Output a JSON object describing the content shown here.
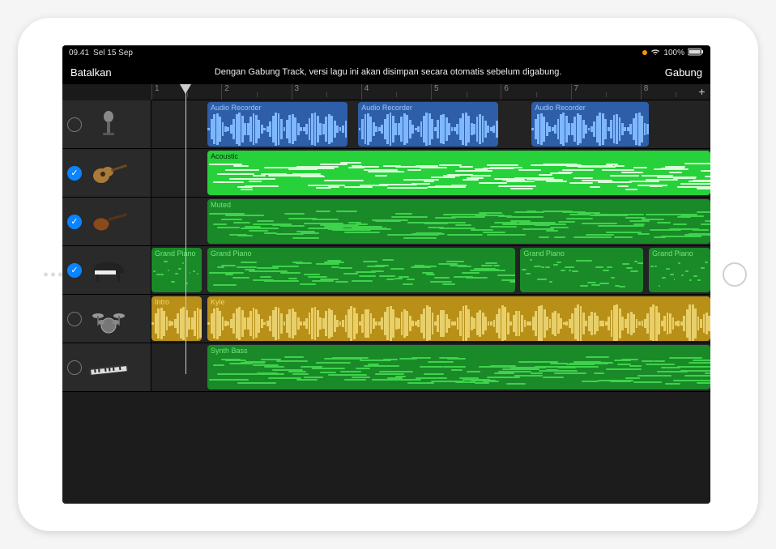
{
  "status": {
    "time": "09.41",
    "date": "Sel 15 Sep",
    "battery": "100%"
  },
  "header": {
    "cancel": "Batalkan",
    "message": "Dengan Gabung Track, versi lagu ini akan disimpan secara otomatis sebelum digabung.",
    "merge": "Gabung"
  },
  "ruler": {
    "marks": [
      "1",
      "2",
      "3",
      "4",
      "5",
      "6",
      "7",
      "8"
    ],
    "add_label": "+"
  },
  "tracks": [
    {
      "id": "mic",
      "instrument": "microphone",
      "checked": false,
      "regions": [
        {
          "label": "Audio Recorder",
          "type": "audio",
          "start": 10,
          "width": 25
        },
        {
          "label": "Audio Recorder",
          "type": "audio",
          "start": 37,
          "width": 25
        },
        {
          "label": "Audio Recorder",
          "type": "audio",
          "start": 68,
          "width": 21
        }
      ]
    },
    {
      "id": "acoustic-guitar",
      "instrument": "acoustic-guitar",
      "checked": true,
      "regions": [
        {
          "label": "Acoustic",
          "type": "midi-bright",
          "start": 10,
          "width": 90
        }
      ]
    },
    {
      "id": "bass-guitar",
      "instrument": "bass-guitar",
      "checked": true,
      "regions": [
        {
          "label": "Muted",
          "type": "midi-dark",
          "start": 10,
          "width": 90
        }
      ]
    },
    {
      "id": "piano",
      "instrument": "grand-piano",
      "checked": true,
      "regions": [
        {
          "label": "Grand Piano",
          "type": "midi-dark",
          "start": 0,
          "width": 9
        },
        {
          "label": "Grand Piano",
          "type": "midi-dark",
          "start": 10,
          "width": 55
        },
        {
          "label": "Grand Piano",
          "type": "midi-dark",
          "start": 66,
          "width": 22
        },
        {
          "label": "Grand Piano",
          "type": "midi-dark",
          "start": 89,
          "width": 11
        }
      ]
    },
    {
      "id": "drums",
      "instrument": "drum-kit",
      "checked": false,
      "regions": [
        {
          "label": "Intro",
          "type": "drum",
          "start": 0,
          "width": 9
        },
        {
          "label": "Kyle",
          "type": "drum",
          "start": 10,
          "width": 90
        }
      ]
    },
    {
      "id": "synth",
      "instrument": "keyboard-synth",
      "checked": false,
      "regions": [
        {
          "label": "Synth Bass",
          "type": "midi-dark",
          "start": 10,
          "width": 90
        }
      ]
    }
  ]
}
